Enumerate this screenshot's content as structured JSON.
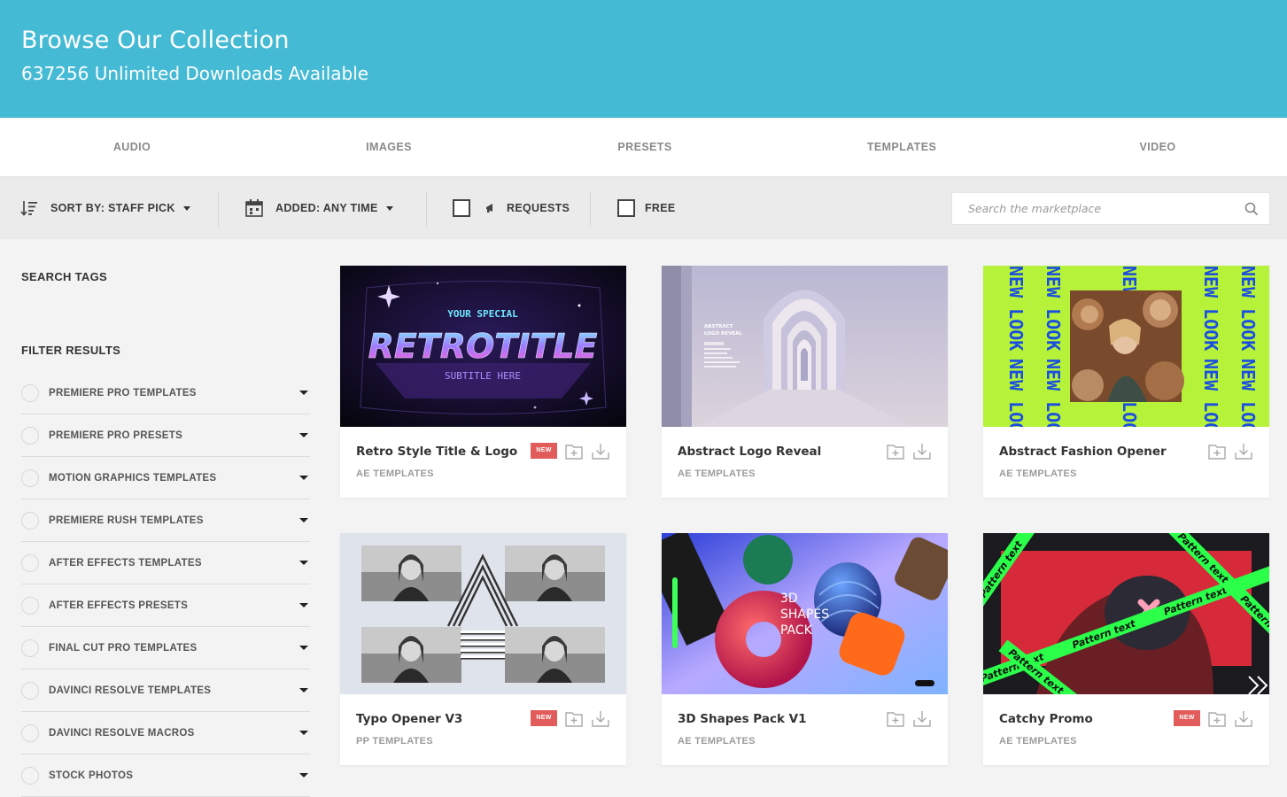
{
  "header": {
    "title": "Browse Our Collection",
    "subtitle": "637256 Unlimited Downloads Available"
  },
  "tabs": [
    "AUDIO",
    "IMAGES",
    "PRESETS",
    "TEMPLATES",
    "VIDEO"
  ],
  "filters": {
    "sort_label": "SORT BY: STAFF PICK",
    "added_label": "ADDED: ANY TIME",
    "requests_label": "REQUESTS",
    "free_label": "FREE",
    "search_placeholder": "Search the marketplace"
  },
  "sidebar": {
    "search_tags_heading": "SEARCH TAGS",
    "filter_heading": "FILTER RESULTS",
    "categories": [
      "PREMIERE PRO TEMPLATES",
      "PREMIERE PRO PRESETS",
      "MOTION GRAPHICS TEMPLATES",
      "PREMIERE RUSH TEMPLATES",
      "AFTER EFFECTS TEMPLATES",
      "AFTER EFFECTS PRESETS",
      "FINAL CUT PRO TEMPLATES",
      "DAVINCI RESOLVE TEMPLATES",
      "DAVINCI RESOLVE MACROS",
      "STOCK PHOTOS"
    ]
  },
  "items": [
    {
      "title": "Retro Style Title & Logo",
      "category": "AE TEMPLATES",
      "badge": "NEW",
      "is_new": true
    },
    {
      "title": "Abstract Logo Reveal",
      "category": "AE TEMPLATES",
      "badge": "",
      "is_new": false
    },
    {
      "title": "Abstract Fashion Opener",
      "category": "AE TEMPLATES",
      "badge": "",
      "is_new": false
    },
    {
      "title": "Typo Opener V3",
      "category": "PP TEMPLATES",
      "badge": "NEW",
      "is_new": true
    },
    {
      "title": "3D Shapes Pack V1",
      "category": "AE TEMPLATES",
      "badge": "",
      "is_new": false
    },
    {
      "title": "Catchy Promo",
      "category": "AE TEMPLATES",
      "badge": "NEW",
      "is_new": true
    }
  ],
  "thumb_text": {
    "retro_top": "YOUR SPECIAL",
    "retro_main": "RETROTITLE",
    "retro_sub": "SUBTITLE HERE",
    "abstract_l1": "ABSTRACT",
    "abstract_l2": "LOGO REVEAL",
    "fashion_word": "NEW LOOK",
    "shapes_l1": "3D",
    "shapes_l2": "SHAPES",
    "shapes_l3": "PACK",
    "promo_word": "Pattern text"
  },
  "colors": {
    "hero": "#45bad4",
    "badge": "#e25c5c",
    "fashion_lime": "#b6f23a",
    "promo_green": "#2bff4a"
  }
}
